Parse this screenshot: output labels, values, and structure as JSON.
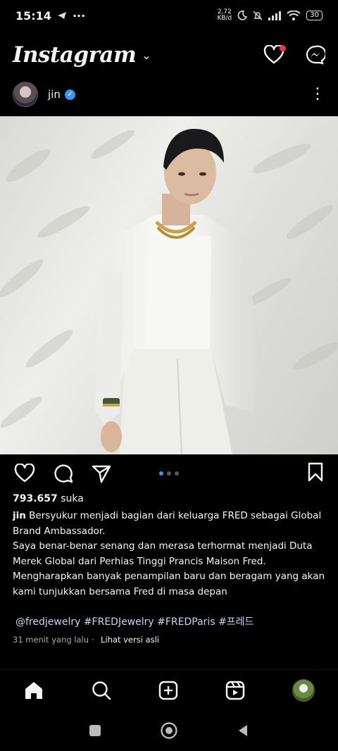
{
  "status_bar": {
    "time": "15:14",
    "extra": "···",
    "net_speed_value": "2,72",
    "net_speed_unit": "KB/d",
    "battery": "30"
  },
  "header": {
    "app_name": "Instagram",
    "chevron": "⌄"
  },
  "post": {
    "username": "jin",
    "verified_mark": "✓",
    "more": "⋮",
    "carousel_count": 3,
    "carousel_active": 0,
    "likes_value": "793.657",
    "likes_label": "suka",
    "caption_user": "jin",
    "caption_line1": "Bersyukur menjadi bagian dari keluarga FRED sebagai Global Brand Ambassador.",
    "caption_line2": "Saya benar-benar senang dan merasa terhormat menjadi Duta Merek Global dari Perhias Tinggi Prancis Maison Fred.",
    "caption_line3": "Mengharapkan banyak penampilan baru dan beragam yang akan kami tunjukkan bersama Fred di masa depan",
    "hashtags": "@fredjewelry #FREDJewelry #FREDParis #프레드",
    "time_ago": "31 menit yang lalu",
    "separator": "·",
    "see_translation": "Lihat versi asli"
  },
  "icons": [
    "heart-icon",
    "messenger-icon",
    "like-icon",
    "comment-icon",
    "share-icon",
    "save-icon",
    "home-icon",
    "search-icon",
    "create-icon",
    "reels-icon"
  ],
  "colors": {
    "accent_blue": "#3897f0",
    "notification_red": "#ff3040",
    "background": "#000000"
  }
}
